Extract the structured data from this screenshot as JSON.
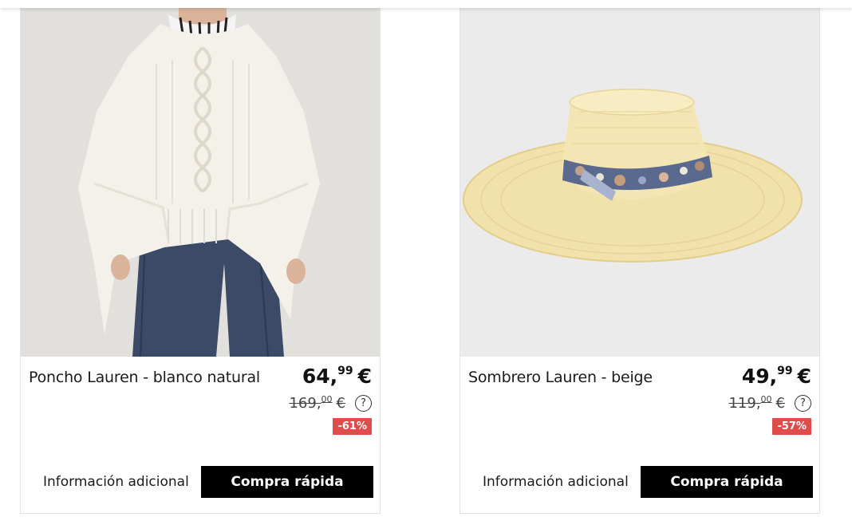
{
  "products": [
    {
      "name": "Poncho Lauren - blanco natural",
      "price_int": "64",
      "price_dec": "99",
      "currency": "€",
      "old_price_int": "169",
      "old_price_dec": "00",
      "discount": "-61%",
      "help_glyph": "?",
      "info_label": "Información adicional",
      "buy_label": "Compra rápida",
      "image_icon": "poncho-photo"
    },
    {
      "name": "Sombrero Lauren - beige",
      "price_int": "49",
      "price_dec": "99",
      "currency": "€",
      "old_price_int": "119",
      "old_price_dec": "00",
      "discount": "-57%",
      "help_glyph": "?",
      "info_label": "Información adicional",
      "buy_label": "Compra rápida",
      "image_icon": "hat-photo"
    }
  ],
  "colors": {
    "badge": "#e04b4b",
    "button": "#000000",
    "card_border": "#e2e2e2"
  }
}
